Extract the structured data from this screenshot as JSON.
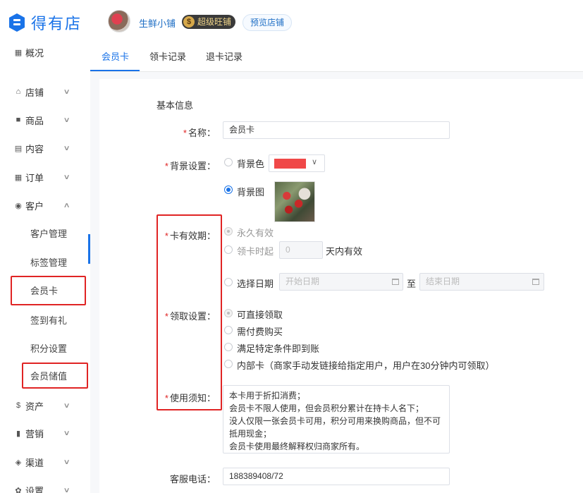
{
  "brand": {
    "name": "得有店",
    "color": "#1a73e8"
  },
  "header": {
    "shop_name": "生鲜小铺",
    "level_badge": "超级旺铺",
    "level_coin": "$",
    "preview_label": "预览店铺"
  },
  "sidebar": {
    "items": [
      {
        "icon": "grid-icon",
        "glyph": "▦",
        "label": "概况"
      },
      {
        "icon": "store-icon",
        "glyph": "⌂",
        "label": "店铺",
        "chevron": "∨"
      },
      {
        "icon": "product-icon",
        "glyph": "■",
        "label": "商品",
        "chevron": "∨"
      },
      {
        "icon": "content-icon",
        "glyph": "▤",
        "label": "内容",
        "chevron": "∨"
      },
      {
        "icon": "order-icon",
        "glyph": "▦",
        "label": "订单",
        "chevron": "∨"
      },
      {
        "icon": "customer-icon",
        "glyph": "◉",
        "label": "客户",
        "chevron": "∧"
      },
      {
        "icon": "asset-icon",
        "glyph": "$",
        "label": "资产",
        "chevron": "∨"
      },
      {
        "icon": "marketing-icon",
        "glyph": "▮",
        "label": "营销",
        "chevron": "∨"
      },
      {
        "icon": "channel-icon",
        "glyph": "◈",
        "label": "渠道",
        "chevron": "∨"
      },
      {
        "icon": "settings-icon",
        "glyph": "✿",
        "label": "设置",
        "chevron": "∨"
      }
    ],
    "sub_items": [
      "客户管理",
      "标签管理",
      "会员卡",
      "签到有礼",
      "积分设置",
      "会员储值"
    ],
    "active_sub": "会员卡"
  },
  "tabs": [
    "会员卡",
    "领卡记录",
    "退卡记录"
  ],
  "form": {
    "section_title": "基本信息",
    "name": {
      "label": "名称：",
      "value": "会员卡"
    },
    "background": {
      "label": "背景设置：",
      "color_option": "背景色",
      "color_value": "#f04848",
      "image_option": "背景图"
    },
    "validity": {
      "label": "卡有效期：",
      "forever": "永久有效",
      "from_claim": "领卡时起",
      "days_placeholder": "0",
      "days_suffix": "天内有效",
      "date_option": "选择日期",
      "start_placeholder": "开始日期",
      "to": "至",
      "end_placeholder": "结束日期"
    },
    "claim": {
      "label": "领取设置：",
      "options": [
        "可直接领取",
        "需付费购买",
        "满足特定条件即到账",
        "内部卡（商家手动发链接给指定用户，用户在30分钟内可领取）"
      ]
    },
    "notice": {
      "label": "使用须知：",
      "text": "本卡用于折扣消费；\n会员卡不限人使用，但会员积分累计在持卡人名下；\n没人仅限一张会员卡可用，积分可用来换购商品，但不可抵用现金；\n会员卡使用最终解释权归商家所有。"
    },
    "phone": {
      "label": "客服电话：",
      "value": "188389408/72"
    }
  }
}
